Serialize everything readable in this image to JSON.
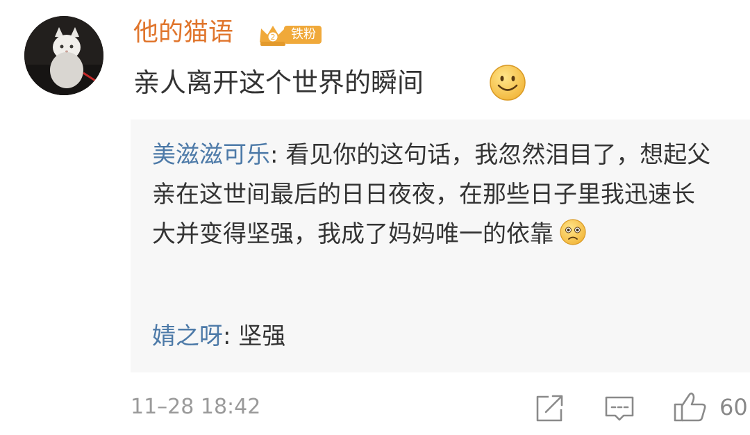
{
  "post": {
    "author": "他的猫语",
    "badge_label": "铁粉",
    "text": "亲人离开这个世界的瞬间",
    "timestamp": "11–28 18:42",
    "like_count": "60"
  },
  "replies": [
    {
      "name": "美滋滋可乐",
      "separator": ": ",
      "text": "看见你的这句话，我忽然泪目了，想起父亲在这世间最后的日日夜夜，在那些日子里我迅速长大并变得坚强，我成了妈妈唯一的依靠"
    },
    {
      "name": "婧之呀",
      "separator": ": ",
      "text": "坚强"
    }
  ],
  "icons": {
    "badge": "crown-icon",
    "post_emoji": "smile-emoji-icon",
    "reply_emoji": "sad-emoji-icon",
    "share": "share-icon",
    "comment": "comment-icon",
    "like": "thumbs-up-icon"
  },
  "colors": {
    "author": "#e0752c",
    "reply_name": "#4d7aa8",
    "badge_bg": "#f0a93a",
    "reply_bg": "#f7f7f7",
    "meta": "#9a9a9a"
  }
}
